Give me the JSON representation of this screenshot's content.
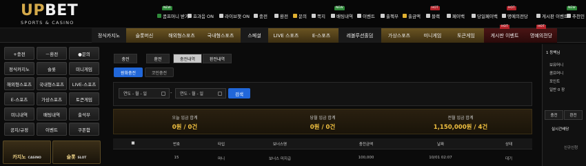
{
  "header": {
    "logo_main_1": "UP",
    "logo_main_2": "BET",
    "logo_sub": "SPORTS & CASINO",
    "links": [
      {
        "label": "콤프머니 받기",
        "icon_color": "#2f8a3a"
      },
      {
        "label": "효과음 ON",
        "icon_color": "#cfcfcf"
      },
      {
        "label": "라이브챗 ON",
        "icon_color": "#cfcfcf"
      },
      {
        "label": "충전",
        "icon_color": "#cfcfcf"
      },
      {
        "label": "환전",
        "icon_color": "#cfcfcf"
      },
      {
        "label": "문의",
        "icon_color": "#e0b030"
      },
      {
        "label": "쪽지",
        "icon_color": "#cfcfcf"
      },
      {
        "label": "배팅내역",
        "icon_color": "#cfcfcf"
      },
      {
        "label": "이벤트",
        "icon_color": "#cfcfcf"
      },
      {
        "label": "출첵부",
        "icon_color": "#cfcfcf"
      },
      {
        "label": "출금액",
        "icon_color": "#e0b030"
      },
      {
        "label": "블랙",
        "icon_color": "#cfcfcf"
      },
      {
        "label": "페이백",
        "icon_color": "#cfcfcf"
      },
      {
        "label": "당일페이백",
        "icon_color": "#cfcfcf"
      },
      {
        "label": "명예의전당",
        "icon_color": "#cfcfcf"
      },
      {
        "label": "게시판 이벤트",
        "icon_color": "#cfcfcf"
      },
      {
        "label": "추천인",
        "icon_color": "#cfcfcf"
      }
    ],
    "badges": [
      {
        "label": "NEW",
        "color": "#2f8a3a"
      },
      {
        "label": "NEW",
        "color": "#2f8a3a"
      },
      {
        "label": "HOT",
        "color": "#b4232a"
      },
      {
        "label": "HOT",
        "color": "#b4232a"
      },
      {
        "label": "NEW",
        "color": "#2f8a3a"
      }
    ]
  },
  "nav": {
    "items": [
      {
        "label": "정식카지노",
        "style": "dark"
      },
      {
        "label": "슬롯머신",
        "style": "gold"
      },
      {
        "label": "해외형스포츠",
        "style": "gold"
      },
      {
        "label": "국내형스포츠",
        "style": "gold"
      },
      {
        "label": "스페셜",
        "style": "dark"
      },
      {
        "label": "LIVE 스포츠",
        "style": "gold"
      },
      {
        "label": "E-스포츠",
        "style": "gold"
      },
      {
        "label": "레볼루션홀덤",
        "style": "dark"
      },
      {
        "label": "가상스포츠",
        "style": "gold"
      },
      {
        "label": "미니게임",
        "style": "gold"
      },
      {
        "label": "토큰게임",
        "style": "gold"
      },
      {
        "label": "게시판 이벤트",
        "style": "red"
      },
      {
        "label": "명예의전당",
        "style": "red"
      }
    ],
    "hot_label": "HOT"
  },
  "sidebar": {
    "buttons": [
      "+충전",
      "－환전",
      "●문의",
      "정식카지노",
      "슬롯",
      "미니게임",
      "해외형스포츠",
      "국내형스포츠",
      "LIVE-스포츠",
      "E-스포츠",
      "가상스포츠",
      "토큰게임",
      "미니내역",
      "배팅내역",
      "출석부",
      "공지/규정",
      "이벤트",
      "쿠폰함"
    ],
    "promos": [
      {
        "label": "카지노",
        "tag": "CASINO"
      },
      {
        "label": "슬롯",
        "tag": "SLOT"
      }
    ]
  },
  "main": {
    "tabs": [
      "충전",
      "환전",
      "충전내역",
      "환전내역"
    ],
    "active_tab_index": 2,
    "subtabs": [
      "원화충전",
      "코인충전"
    ],
    "active_subtab_index": 0,
    "filter": {
      "date_from": "연도 - 월 - 일",
      "separator": "-",
      "date_to": "연도 - 월 - 일",
      "search_label": "검색"
    },
    "summary": [
      {
        "label": "오늘 입금 합계",
        "value": "0원 / 0건"
      },
      {
        "label": "당월 입금 합계",
        "value": "0원 / 0건"
      },
      {
        "label": "전월 입금 합계",
        "value": "1,150,000원 / 4건"
      }
    ],
    "table": {
      "headers": [
        "■",
        "번호",
        "타입",
        "보너스명",
        "충전금액",
        "날짜",
        "상태"
      ],
      "rows": [
        [
          "",
          "15",
          "머니",
          "보너스 미지급",
          "100,000",
          "10/01 02:07",
          "대기"
        ]
      ]
    }
  },
  "right_panel": {
    "user_level": "1 등백님",
    "items": [
      "보유머니",
      "콤프머니",
      "포인트",
      "일반 0 장"
    ],
    "buttons": [
      "충전",
      "환전"
    ],
    "live_label": "실시간배당",
    "footer": "신규신청"
  },
  "colors": {
    "accent_gold": "#d4a94a",
    "search_blue": "#2167d9",
    "summary_value": "#f0c040"
  }
}
